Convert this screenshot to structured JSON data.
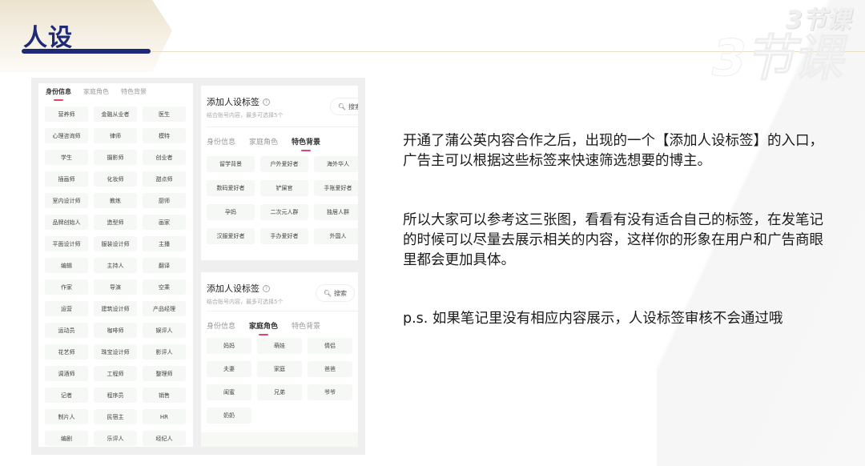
{
  "header": {
    "title": "人设",
    "logo_text": "3节课"
  },
  "left_panel": {
    "tabs": [
      {
        "label": "身份信息",
        "active": true
      },
      {
        "label": "家庭角色",
        "active": false
      },
      {
        "label": "特色背景",
        "active": false
      }
    ],
    "tags": [
      "营养师",
      "金融从业者",
      "医生",
      "心理咨询师",
      "律师",
      "模特",
      "学生",
      "摄影师",
      "创业者",
      "插画师",
      "化妆师",
      "甜点师",
      "室内设计师",
      "教练",
      "厨师",
      "品牌创始人",
      "造型师",
      "画家",
      "平面设计师",
      "服装设计师",
      "主播",
      "编辑",
      "主持人",
      "翻译",
      "作家",
      "导演",
      "空乘",
      "运营",
      "建筑设计师",
      "产品经理",
      "运动员",
      "咖啡师",
      "娱评人",
      "花艺师",
      "珠宝设计师",
      "影评人",
      "调酒师",
      "工程师",
      "整理师",
      "记者",
      "程序员",
      "销售",
      "制片人",
      "民宿主",
      "HR",
      "编剧",
      "乐评人",
      "经纪人"
    ]
  },
  "right_top_panel": {
    "title": "添加人设标签",
    "help_icon": "?",
    "subtitle": "结合账号内容，最多可选择5个",
    "search_label": "搜索",
    "tabs": [
      {
        "label": "身份信息",
        "active": false
      },
      {
        "label": "家庭角色",
        "active": false
      },
      {
        "label": "特色背景",
        "active": true
      }
    ],
    "tags": [
      "留学背景",
      "户外爱好者",
      "海外华人",
      "数码爱好者",
      "铲屎官",
      "手账爱好者",
      "孕妈",
      "二次元人群",
      "独居人群",
      "汉服爱好者",
      "手办爱好者",
      "外国人"
    ]
  },
  "right_bottom_panel": {
    "title": "添加人设标签",
    "help_icon": "?",
    "subtitle": "结合账号内容，最多可选择5个",
    "search_label": "搜索",
    "tabs": [
      {
        "label": "身份信息",
        "active": false
      },
      {
        "label": "家庭角色",
        "active": true
      },
      {
        "label": "特色背景",
        "active": false
      }
    ],
    "tags": [
      "妈妈",
      "萌娃",
      "情侣",
      "夫妻",
      "家庭",
      "爸爸",
      "闺蜜",
      "兄弟",
      "爷爷",
      "奶奶"
    ]
  },
  "body": {
    "paragraph_1": "开通了蒲公英内容合作之后，出现的一个【添加人设标签】的入口，广告主可以根据这些标签来快速筛选想要的博主。",
    "paragraph_2": "所以大家可以参考这三张图，看看有没有适合自己的标签，在发笔记的时候可以尽量去展示相关的内容，这样你的形象在用户和广告商眼里都会更加具体。",
    "paragraph_3": "p.s. 如果笔记里没有相应内容展示，人设标签审核不会通过哦"
  },
  "colors": {
    "title_navy": "#1e2a78",
    "active_tab_underline": "#e0466a",
    "tag_bg": "#f5f8f4"
  }
}
